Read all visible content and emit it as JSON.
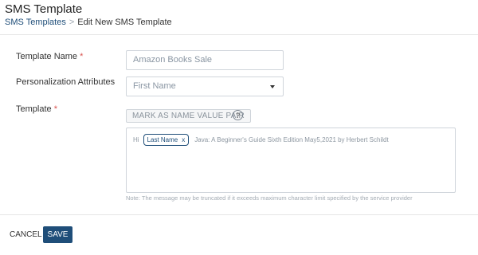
{
  "header": {
    "title": "SMS Template",
    "breadcrumb": {
      "parent": "SMS Templates",
      "separator": ">",
      "current": "Edit New SMS Template"
    }
  },
  "form": {
    "template_name": {
      "label": "Template Name",
      "required_mark": "*",
      "value": "Amazon Books Sale"
    },
    "personalization": {
      "label": "Personalization Attributes",
      "selected": "First Name"
    },
    "template": {
      "label": "Template",
      "required_mark": "*",
      "mark_button_label": "MARK AS NAME VALUE PAIR",
      "help_icon_glyph": "?",
      "content": {
        "prefix": "Hi",
        "chip_label": "Last Name",
        "chip_close": "x",
        "text": "Java: A Beginner's Guide Sixth Edition May5,2021 by Herbert Schildt"
      },
      "note": "Note: The message may be truncated if it exceeds maximum character limit specified by the service provider"
    }
  },
  "footer": {
    "cancel_label": "CANCEL",
    "save_label": "SAVE"
  },
  "colors": {
    "primary": "#1f4e79",
    "required": "#d9534f"
  }
}
